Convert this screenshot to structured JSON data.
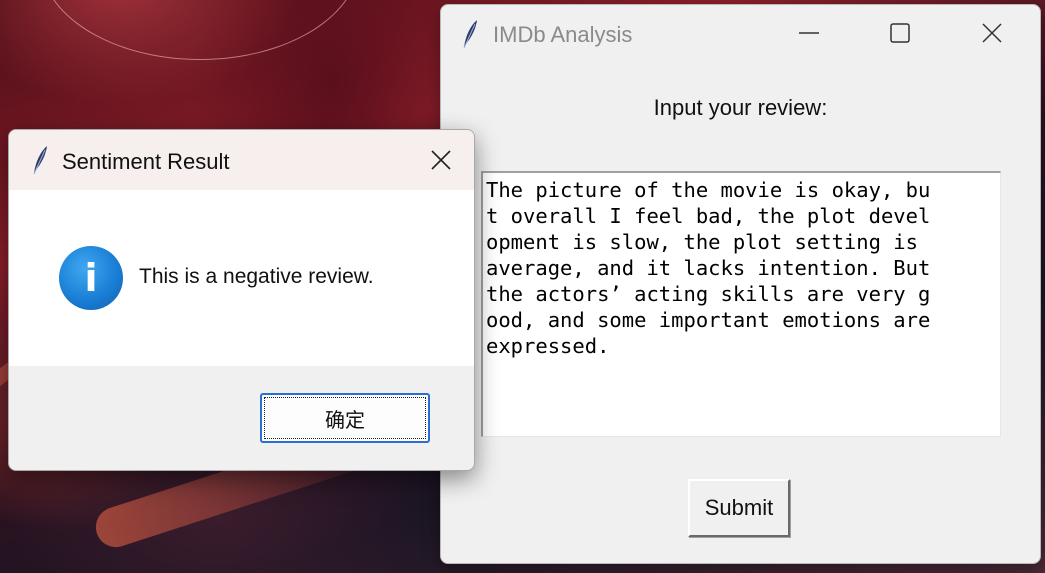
{
  "main_window": {
    "title": "IMDb Analysis",
    "app_icon": "feather-icon",
    "controls": [
      "minimize-icon",
      "maximize-icon",
      "close-icon"
    ],
    "prompt_label": "Input your review:",
    "review_lines": [
      "The picture of the movie is okay, bu",
      "t overall I feel bad, the plot devel",
      "opment is slow, the plot setting is ",
      "average, and it lacks intention. But",
      "the actors’ acting skills are very g",
      "ood, and some important emotions are",
      "expressed."
    ],
    "submit_label": "Submit"
  },
  "dialog": {
    "title": "Sentiment Result",
    "app_icon": "feather-icon",
    "close_icon": "close-icon",
    "info_icon": "info-icon",
    "info_glyph": "i",
    "message": "This is a negative review.",
    "ok_label": "确定"
  },
  "colors": {
    "window_bg": "#f0f0f0",
    "dialog_titlebar": "#f7eeee",
    "info_blue": "#1a7fd6",
    "focus_border": "#2a6fd0"
  }
}
